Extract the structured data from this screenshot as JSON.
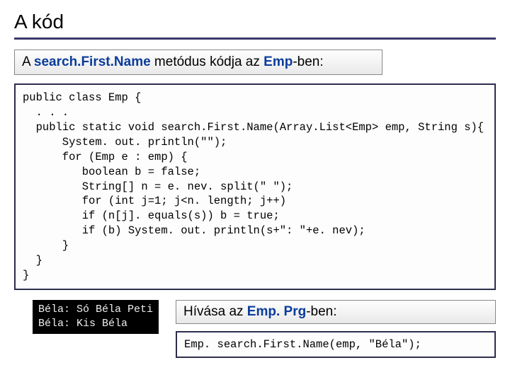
{
  "title": "A kód",
  "subtitle": {
    "prefix": "A ",
    "method": "search.First.Name",
    "mid": " metódus kódja az ",
    "class": "Emp",
    "suffix": "-ben:"
  },
  "code": "public class Emp {\n  . . .\n  public static void search.First.Name(Array.List<Emp> emp, String s){\n      System. out. println(\"\");\n      for (Emp e : emp) {\n         boolean b = false;\n         String[] n = e. nev. split(\" \");\n         for (int j=1; j<n. length; j++)\n         if (n[j]. equals(s)) b = true;\n         if (b) System. out. println(s+\": \"+e. nev);\n      }\n  }\n}",
  "console": "Béla: Só Béla Peti\nBéla: Kis Béla",
  "call_label": {
    "prefix": "Hívása az ",
    "class": "Emp. Prg",
    "suffix": "-ben:"
  },
  "call_code": "Emp. search.First.Name(emp, \"Béla\");"
}
